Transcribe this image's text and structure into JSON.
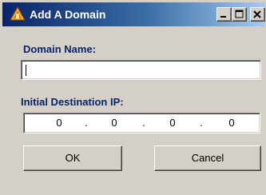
{
  "window": {
    "title": "Add A Domain",
    "icon": "domain-app-icon",
    "controls": {
      "minimize": "minimize-icon",
      "maximize": "maximize-icon",
      "close": "close-icon"
    }
  },
  "form": {
    "domain_label": "Domain Name:",
    "domain_value": "",
    "ip_label": "Initial Destination IP:",
    "ip_octets": [
      "0",
      "0",
      "0",
      "0"
    ],
    "ip_separator": "."
  },
  "buttons": {
    "ok": "OK",
    "cancel": "Cancel"
  },
  "colors": {
    "titlebar_start": "#0a246a",
    "titlebar_end": "#a6caf0",
    "label_color": "#0a246a",
    "face": "#d4d0c8"
  }
}
